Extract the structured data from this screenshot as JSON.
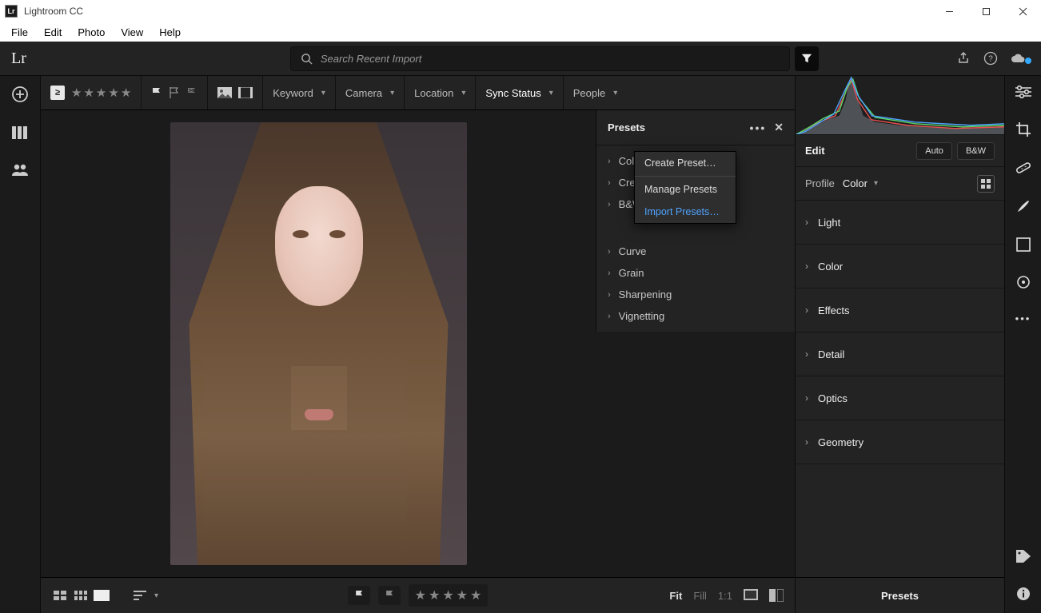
{
  "title": "Lightroom CC",
  "menubar": [
    "File",
    "Edit",
    "Photo",
    "View",
    "Help"
  ],
  "lr_mark": "Lr",
  "search": {
    "placeholder": "Search Recent Import"
  },
  "filters": {
    "keyword": "Keyword",
    "camera": "Camera",
    "location": "Location",
    "sync_status": "Sync Status",
    "people": "People"
  },
  "presets": {
    "title": "Presets",
    "groups_a": [
      "Color",
      "Creative",
      "B&W"
    ],
    "groups_b": [
      "Curve",
      "Grain",
      "Sharpening",
      "Vignetting"
    ]
  },
  "ctx_menu": {
    "create": "Create Preset…",
    "manage": "Manage Presets",
    "import": "Import Presets…"
  },
  "edit": {
    "title": "Edit",
    "auto": "Auto",
    "bw": "B&W",
    "profile_label": "Profile",
    "profile_value": "Color",
    "sections": [
      "Light",
      "Color",
      "Effects",
      "Detail",
      "Optics",
      "Geometry"
    ],
    "presets_footer": "Presets"
  },
  "zoom": {
    "fit": "Fit",
    "fill": "Fill",
    "oneone": "1:1"
  }
}
